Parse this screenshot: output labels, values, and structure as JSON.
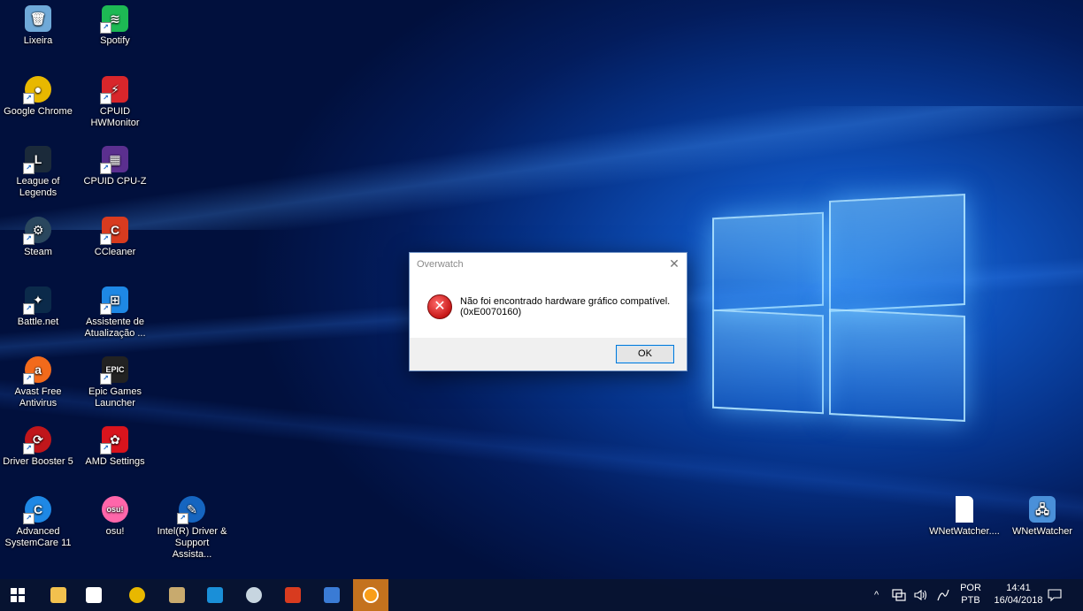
{
  "desktop": {
    "icons": [
      {
        "label": "Lixeira",
        "icon": "recycle-bin-icon",
        "color": "#6fa9d8"
      },
      {
        "label": "Spotify",
        "icon": "spotify-icon",
        "color": "#1db954"
      },
      {
        "label": "Google Chrome",
        "icon": "chrome-icon",
        "color": "#e8b800"
      },
      {
        "label": "CPUID HWMonitor",
        "icon": "hwmonitor-icon",
        "color": "#d8262b"
      },
      {
        "label": "League of Legends",
        "icon": "league-icon",
        "color": "#1b2a3a"
      },
      {
        "label": "CPUID CPU-Z",
        "icon": "cpuz-icon",
        "color": "#5b2f8f"
      },
      {
        "label": "Steam",
        "icon": "steam-icon",
        "color": "#2a475e"
      },
      {
        "label": "CCleaner",
        "icon": "ccleaner-icon",
        "color": "#d83b1f"
      },
      {
        "label": "Battle.net",
        "icon": "battlenet-icon",
        "color": "#0b2a4a"
      },
      {
        "label": "Assistente de Atualização ...",
        "icon": "windows-update-assistant-icon",
        "color": "#1e88e5"
      },
      {
        "label": "Avast Free Antivirus",
        "icon": "avast-icon",
        "color": "#f26a1b"
      },
      {
        "label": "Epic Games Launcher",
        "icon": "epic-games-icon",
        "color": "#222222"
      },
      {
        "label": "Driver Booster 5",
        "icon": "driver-booster-icon",
        "color": "#c0161b"
      },
      {
        "label": "AMD Settings",
        "icon": "amd-icon",
        "color": "#d9141d"
      },
      {
        "label": "Advanced SystemCare 11",
        "icon": "systemcare-icon",
        "color": "#1e88e5"
      },
      {
        "label": "osu!",
        "icon": "osu-icon",
        "color": "#ff66aa"
      },
      {
        "label": "Intel(R) Driver & Support Assista...",
        "icon": "intel-driver-icon",
        "color": "#1565c0"
      },
      {
        "label": "WNetWatcher....",
        "icon": "file-icon",
        "color": "#ffffff"
      },
      {
        "label": "WNetWatcher",
        "icon": "wnetwatcher-icon",
        "color": "#4a90d9"
      }
    ]
  },
  "dialog": {
    "title": "Overwatch",
    "message_line1": "Não foi encontrado hardware gráfico compatível.",
    "message_line2": "(0xE0070160)",
    "ok_label": "OK",
    "close_glyph": "✕",
    "error_glyph": "✕"
  },
  "taskbar": {
    "apps": [
      {
        "icon": "start-windows-icon",
        "color": "#ffffff"
      },
      {
        "icon": "file-explorer-icon",
        "color": "#f2c14e"
      },
      {
        "icon": "microsoft-store-icon",
        "color": "#ffffff"
      },
      {
        "icon": "chrome-icon",
        "color": "#e8b800"
      },
      {
        "icon": "league-icon",
        "color": "#c8aa6e"
      },
      {
        "icon": "battlenet-icon",
        "color": "#1a8fd8"
      },
      {
        "icon": "steam-icon",
        "color": "#c7d5e0"
      },
      {
        "icon": "ccleaner-icon",
        "color": "#d83b1f"
      },
      {
        "icon": "card-app-icon",
        "color": "#3a7bd5"
      },
      {
        "icon": "overwatch-icon",
        "color": "#f99e1a"
      }
    ],
    "tray": {
      "language_top": "POR",
      "language_bottom": "PTB",
      "time": "14:41",
      "date": "16/04/2018",
      "chevron": "^"
    }
  }
}
